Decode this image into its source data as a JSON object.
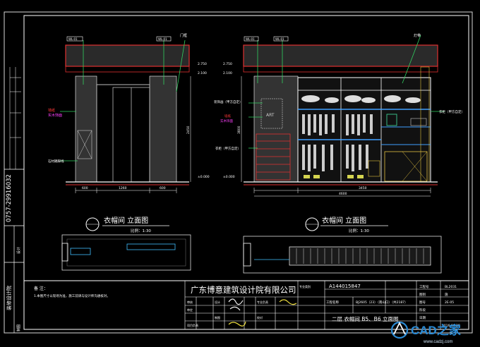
{
  "drawing": {
    "left_elevation": {
      "title": "衣帽间 立面图",
      "scale": "比例：1:30",
      "tags": [
        "WL-01",
        "WL-01"
      ],
      "door_label": "门框",
      "label_red": "墙纸",
      "label_magenta": "实木饰面",
      "label_side": "石材踢脚线",
      "elev_marks": [
        "2.750",
        "2.100",
        "±0.000"
      ],
      "dims": [
        "600",
        "1260",
        "600",
        "2450"
      ]
    },
    "right_elevation": {
      "title": "衣帽间 立面图",
      "scale": "比例：1:30",
      "tags": [
        "WL-01",
        "WL-01"
      ],
      "art": "ART",
      "labels_left": [
        "装饰画（甲方自定）",
        "墙纸",
        "实木饰面",
        "衣柜（甲方自定）"
      ],
      "label_top": "灯带",
      "label_right": "衣柜（甲方自定）",
      "elev_marks": [
        "2.750",
        "2.100",
        "±0.000"
      ],
      "dims": [
        "3800",
        "3450",
        "4600"
      ]
    },
    "sidebar": {
      "phone": "0757-29916032",
      "stamp1": "装修设计院",
      "stamp2": "设计",
      "stamp3": "制图"
    },
    "title_block": {
      "notes_heading": "备 注：",
      "notes": "1.本图尺寸以现场为准，施工前请与设计师沟通核对。",
      "company": "广东博意建筑设计院有限公司",
      "code": "A144015847",
      "project_label": "工程名称",
      "project": "BJ2605（23）（南山口）（共2187）",
      "sheet_name": "二层 衣帽间 B5、B6 立面图",
      "labels": [
        "审核",
        "审定",
        "专业负责",
        "项目负责",
        "设计",
        "制图",
        "校对",
        "专业类别"
      ],
      "right_labels": [
        "工程号",
        "图别",
        "图号",
        "阶段",
        "日期"
      ],
      "right_values": [
        "BL2031",
        "施",
        "2E-05",
        "",
        "2016.06.28"
      ]
    },
    "watermark": {
      "brand": "CAD之家",
      "url": "www.cadzj.com"
    }
  }
}
